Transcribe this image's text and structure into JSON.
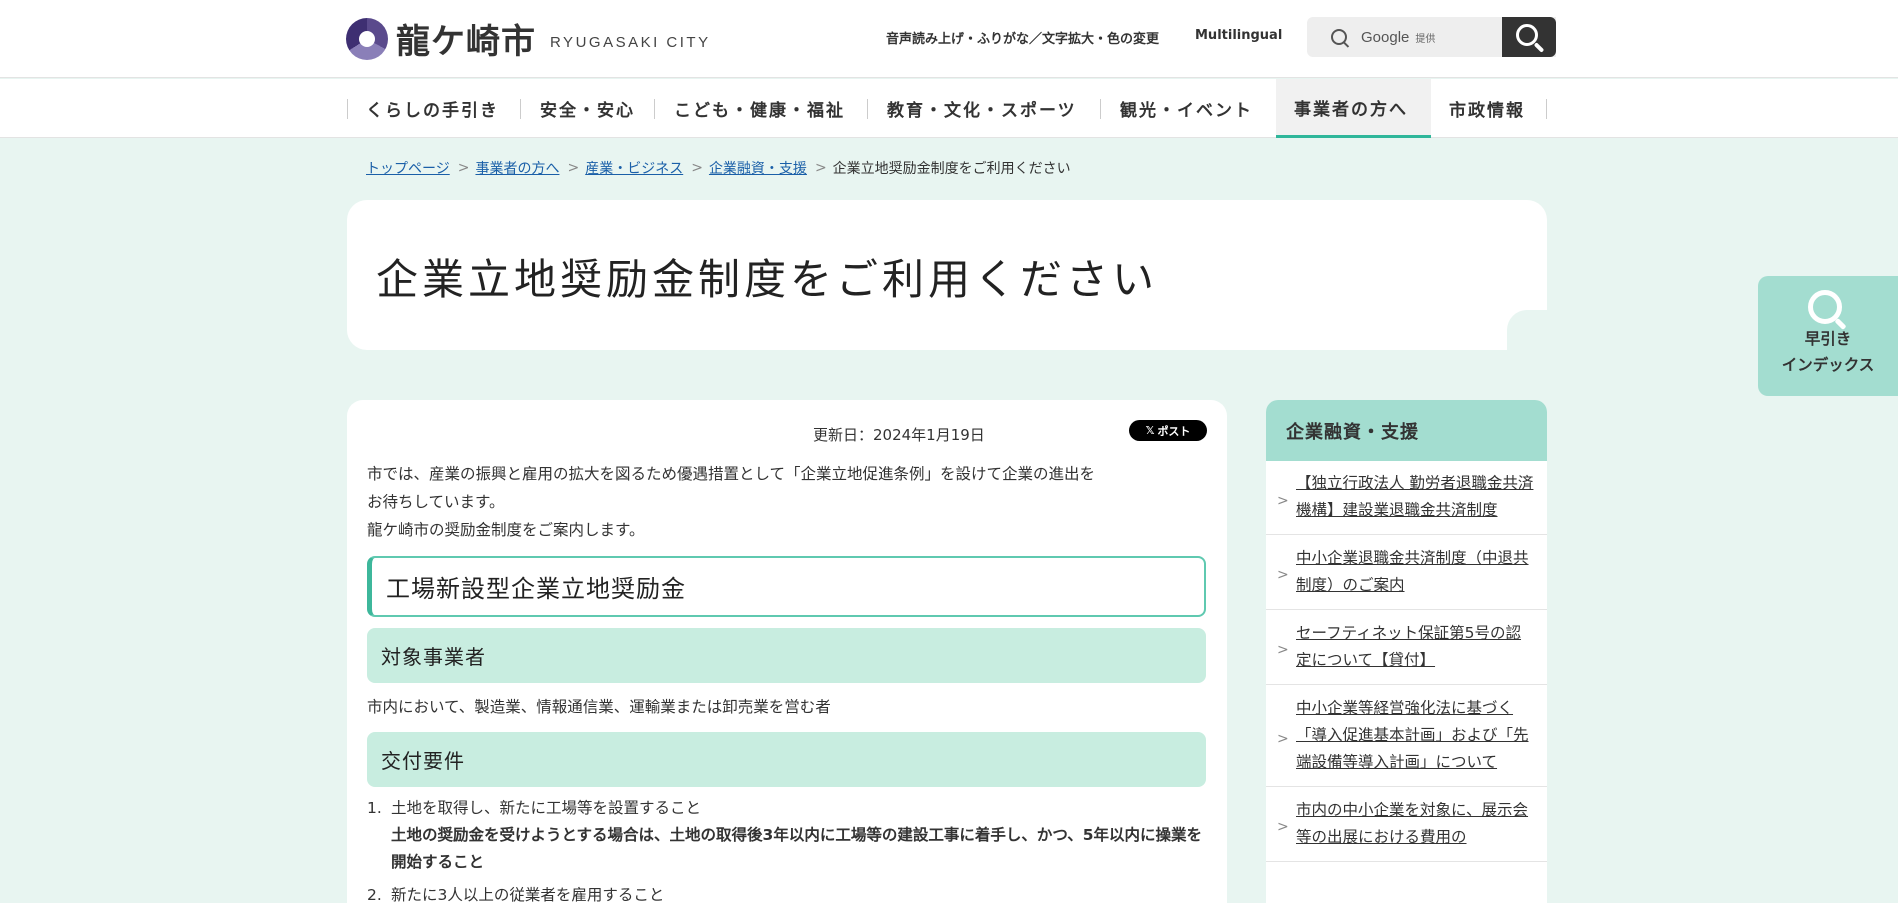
{
  "header": {
    "logo_jp": "龍ケ崎市",
    "logo_en": "RYUGASAKI CITY",
    "accessibility_link": "音声読み上げ・ふりがな／文字拡大・色の変更",
    "multilingual_link": "Multilingual",
    "search_placeholder": "Google",
    "search_provider": "提供"
  },
  "gnav": {
    "items": [
      {
        "label": "くらしの手引き"
      },
      {
        "label": "安全・安心"
      },
      {
        "label": "こども・健康・福祉"
      },
      {
        "label": "教育・文化・スポーツ"
      },
      {
        "label": "観光・イベント"
      },
      {
        "label": "事業者の方へ"
      },
      {
        "label": "市政情報"
      }
    ]
  },
  "breadcrumb": {
    "items": [
      "トップページ",
      "事業者の方へ",
      "産業・ビジネス",
      "企業融資・支援"
    ],
    "current": "企業立地奨励金制度をご利用ください",
    "separator": ">"
  },
  "page": {
    "title": "企業立地奨励金制度をご利用ください",
    "updated": "更新日：2024年1月19日",
    "x_post": "ポスト",
    "x_icon": "𝕏",
    "intro_lines": [
      "市では、産業の振興と雇用の拡大を図るため優遇措置として「企業立地促進条例」を設けて企業の進出を",
      "お待ちしています。",
      "龍ケ崎市の奨励金制度をご案内します。"
    ],
    "h2": "工場新設型企業立地奨励金",
    "h3_target": "対象事業者",
    "target_text": "市内において、製造業、情報通信業、運輸業または卸売業を営む者",
    "h3_requirements": "交付要件",
    "requirements": [
      {
        "num": "1.",
        "text": "土地を取得し、新たに工場等を設置すること",
        "bold": "土地の奨励金を受けようとする場合は、土地の取得後3年以内に工場等の建設工事に着手し、かつ、5年以内に操業を開始すること"
      },
      {
        "num": "2.",
        "text": "新たに3人以上の従業者を雇用すること"
      }
    ]
  },
  "sidebar": {
    "heading": "企業融資・支援",
    "chevron": ">",
    "items": [
      {
        "label": "【独立行政法人 勤労者退職金共済機構】建設業退職金共済制度"
      },
      {
        "label": "中小企業退職金共済制度（中退共制度）のご案内"
      },
      {
        "label": "セーフティネット保証第5号の認定について【貸付】"
      },
      {
        "label": "中小企業等経営強化法に基づく「導入促進基本計画」および「先端設備等導入計画」について"
      },
      {
        "label": "市内の中小企業を対象に、展示会等の出展における費用の"
      }
    ]
  },
  "float_index": {
    "line1": "早引き",
    "line2": "インデックス"
  },
  "colors": {
    "accent": "#2fb69a",
    "mint_light": "#c8ede0",
    "mint": "#a3ddd0",
    "page_bg": "#e8f5f1",
    "link": "#1a5fa8"
  }
}
